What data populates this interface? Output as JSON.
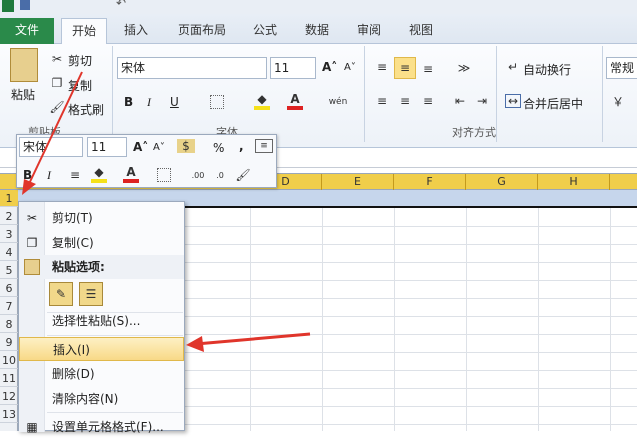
{
  "tabs": [
    "文件",
    "开始",
    "插入",
    "页面布局",
    "公式",
    "数据",
    "审阅",
    "视图"
  ],
  "clipboard": {
    "paste": "粘贴",
    "cut": "剪切",
    "copy": "复制",
    "format_painter": "格式刷",
    "group": "剪贴板"
  },
  "font": {
    "name": "宋体",
    "size": "11",
    "bold": "B",
    "italic": "I",
    "underline": "U",
    "group": "字体"
  },
  "alignment": {
    "wrap": "自动换行",
    "merge": "合并后居中",
    "group": "对齐方式"
  },
  "number": {
    "format": "常规"
  },
  "mini_toolbar": {
    "font": "宋体",
    "size": "11",
    "percent": "%",
    "comma": ",",
    "bold": "B",
    "italic": "I"
  },
  "columns": [
    "D",
    "E",
    "F",
    "G",
    "H"
  ],
  "rows": [
    "1",
    "2",
    "3",
    "4",
    "5",
    "6",
    "7",
    "8",
    "9",
    "10",
    "11",
    "12",
    "13"
  ],
  "context_menu": {
    "cut": "剪切(T)",
    "copy": "复制(C)",
    "paste_options": "粘贴选项:",
    "paste_special": "选择性粘贴(S)...",
    "insert": "插入(I)",
    "delete": "删除(D)",
    "clear": "清除内容(N)",
    "format_cells": "设置单元格格式(F)..."
  }
}
